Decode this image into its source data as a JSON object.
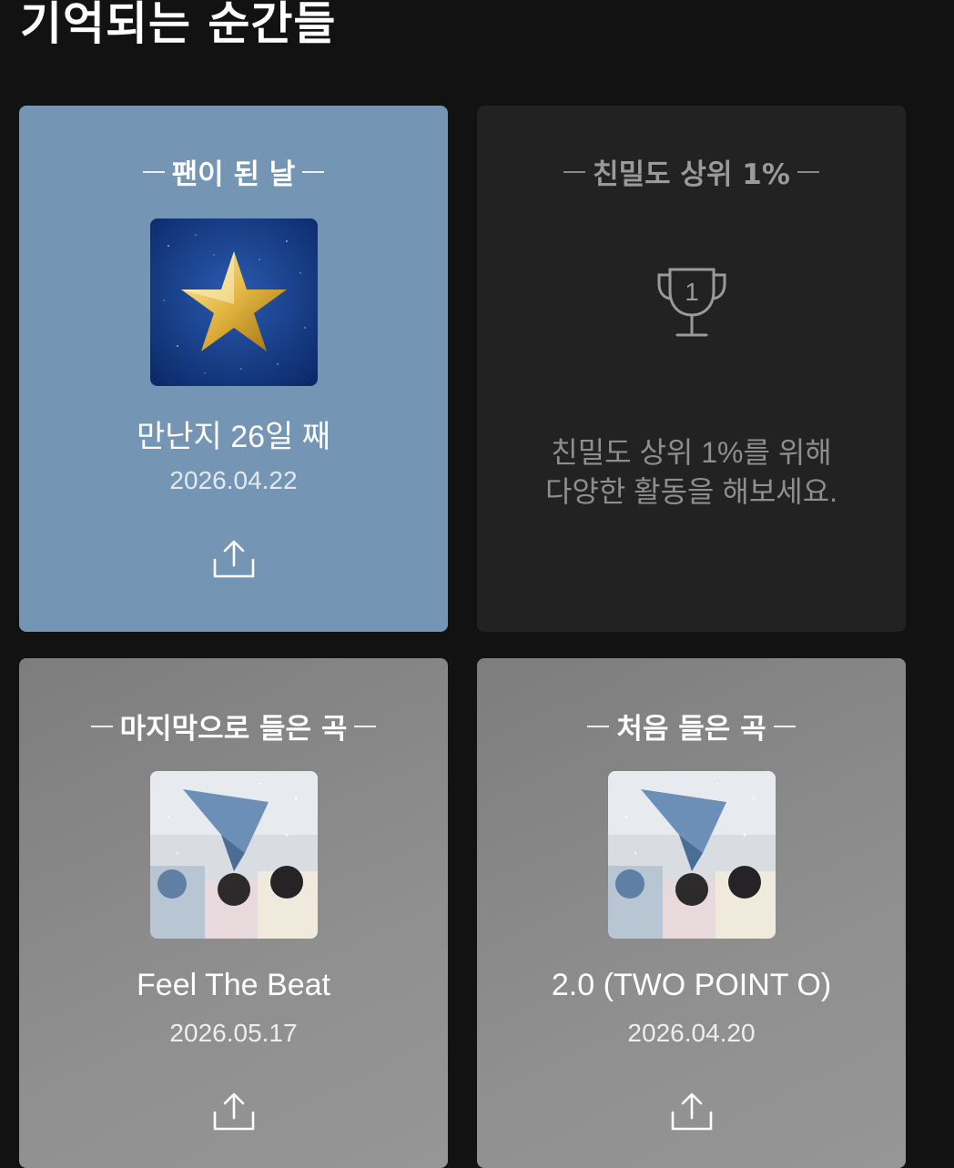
{
  "page": {
    "title": "기억되는 순간들"
  },
  "cards": {
    "fan_day": {
      "header": "팬이 된 날",
      "image_icon": "gold-star-icon",
      "title": "만난지 26일 째",
      "date": "2026.04.22",
      "share_icon": "share-icon"
    },
    "intimacy": {
      "header": "친밀도 상위 1%",
      "icon": "trophy-icon",
      "message_line1": "친밀도 상위 1%를 위해",
      "message_line2": "다양한 활동을 해보세요."
    },
    "last_song": {
      "header": "마지막으로 들은 곡",
      "image_icon": "album-cover",
      "title": "Feel The Beat",
      "date": "2026.05.17",
      "share_icon": "share-icon"
    },
    "first_song": {
      "header": "처음 들은 곡",
      "image_icon": "album-cover",
      "title": "2.0 (TWO POINT O)",
      "date": "2026.04.20",
      "share_icon": "share-icon"
    }
  },
  "colors": {
    "background": "#121212",
    "fan_card": "#7595b5",
    "intimacy_card": "#222222",
    "song_card": "#8c8c8c"
  }
}
